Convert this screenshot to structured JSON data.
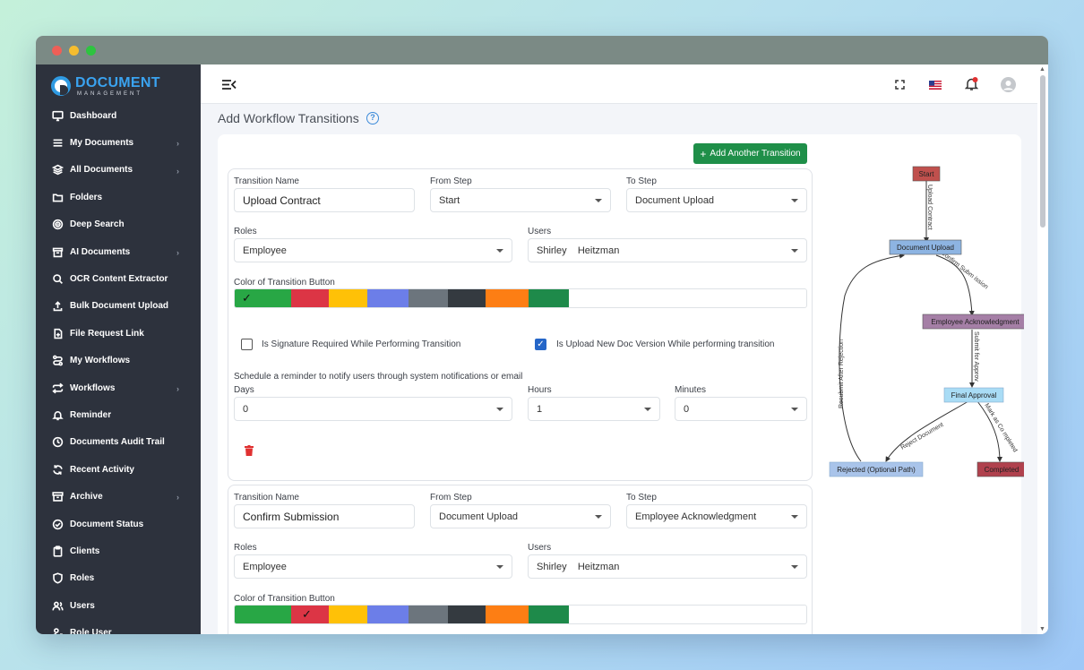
{
  "sidebar": {
    "logo_title": "DOCUMENT",
    "logo_subtitle": "MANAGEMENT",
    "items": [
      {
        "label": "Dashboard",
        "icon": "monitor-icon",
        "submenu": false
      },
      {
        "label": "My Documents",
        "icon": "list-icon",
        "submenu": true
      },
      {
        "label": "All Documents",
        "icon": "layers-icon",
        "submenu": true
      },
      {
        "label": "Folders",
        "icon": "folder-icon",
        "submenu": false
      },
      {
        "label": "Deep Search",
        "icon": "target-icon",
        "submenu": false
      },
      {
        "label": "AI Documents",
        "icon": "archive-box-icon",
        "submenu": true
      },
      {
        "label": "OCR Content Extractor",
        "icon": "search-icon",
        "submenu": false
      },
      {
        "label": "Bulk Document Upload",
        "icon": "upload-icon",
        "submenu": false
      },
      {
        "label": "File Request Link",
        "icon": "file-plus-icon",
        "submenu": false
      },
      {
        "label": "My Workflows",
        "icon": "route-icon",
        "submenu": false
      },
      {
        "label": "Workflows",
        "icon": "repeat-icon",
        "submenu": true
      },
      {
        "label": "Reminder",
        "icon": "bell-icon",
        "submenu": false
      },
      {
        "label": "Documents Audit Trail",
        "icon": "clock-icon",
        "submenu": false
      },
      {
        "label": "Recent Activity",
        "icon": "refresh-icon",
        "submenu": false
      },
      {
        "label": "Archive",
        "icon": "archive-icon",
        "submenu": true
      },
      {
        "label": "Document Status",
        "icon": "check-circle-icon",
        "submenu": false
      },
      {
        "label": "Clients",
        "icon": "clipboard-icon",
        "submenu": false
      },
      {
        "label": "Roles",
        "icon": "shield-icon",
        "submenu": false
      },
      {
        "label": "Users",
        "icon": "users-icon",
        "submenu": false
      },
      {
        "label": "Role User",
        "icon": "user-key-icon",
        "submenu": false
      }
    ]
  },
  "topbar": {
    "menu_toggle_icon": "menu-collapse-icon",
    "fullscreen_icon": "fullscreen-icon",
    "language_icon": "us-flag-icon",
    "notification_icon": "bell-icon",
    "avatar_icon": "avatar-icon"
  },
  "page": {
    "title": "Add Workflow Transitions",
    "help": "?",
    "add_button": "Add Another Transition",
    "add_button_prefix": "+"
  },
  "labels": {
    "transition_name": "Transition Name",
    "from_step": "From Step",
    "to_step": "To Step",
    "roles": "Roles",
    "users": "Users",
    "color": "Color of Transition Button",
    "signature": "Is Signature Required While Performing Transition",
    "upload_version": "Is Upload New Doc Version While performing transition",
    "reminder": "Schedule a reminder to notify users through system notifications or email",
    "days": "Days",
    "hours": "Hours",
    "minutes": "Minutes"
  },
  "swatch_colors": [
    "#28a745",
    "#dc3545",
    "#ffc107",
    "#6c7ee8",
    "#6c757d",
    "#343a40",
    "#fd7e14",
    "#1e8a4a"
  ],
  "transitions": [
    {
      "name": "Upload Contract",
      "from_step": "Start",
      "to_step": "Document Upload",
      "roles": "Employee",
      "users": "Shirley    Heitzman",
      "selected_color_index": 0,
      "signature_required": false,
      "upload_new_version": true,
      "days": "0",
      "hours": "1",
      "minutes": "0"
    },
    {
      "name": "Confirm Submission",
      "from_step": "Document Upload",
      "to_step": "Employee Acknowledgment",
      "roles": "Employee",
      "users": "Shirley    Heitzman",
      "selected_color_index": 1
    }
  ],
  "diagram": {
    "nodes": {
      "start": "Start",
      "upload": "Document Upload",
      "ack": "Employee Acknowledgment",
      "final": "Final Approval",
      "rejected": "Rejected (Optional Path)",
      "completed": "Completed"
    },
    "edges": {
      "e1": "Upload Contract",
      "e2": "Confirm Subm ission",
      "e3": "Submit for Approv",
      "e4": "Reject Document",
      "e5": "Mark as Co mpleted",
      "e6": "Resubmit After Rejection"
    },
    "colors": {
      "start": "#c0504d",
      "upload": "#8db4e2",
      "ack": "#a57fa6",
      "final": "#a9dcf5",
      "rejected": "#a9c4ea",
      "completed": "#b0414d"
    }
  }
}
